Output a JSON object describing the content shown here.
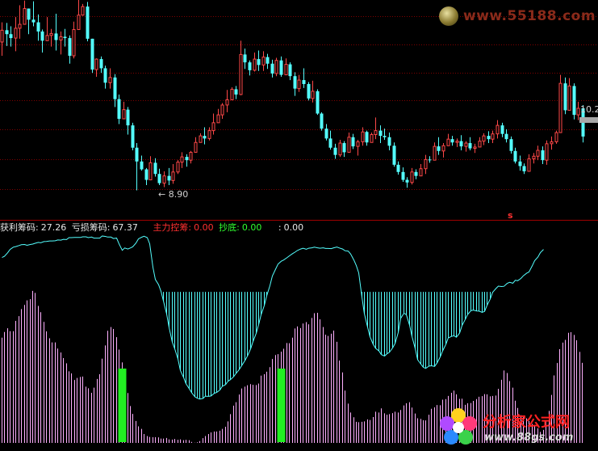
{
  "chart_data": [
    {
      "type": "candlestick",
      "title": "",
      "ylim": [
        8.5,
        11.8
      ],
      "grid": true,
      "annotations": {
        "low_label": "8.90",
        "high_label": "10.2",
        "signal_label": "s"
      },
      "colors": {
        "up": "#ff4848",
        "down": "#54ffff",
        "grid": "#800000"
      },
      "candles": [
        [
          11.16,
          11.46,
          10.95,
          11.34
        ],
        [
          11.34,
          11.45,
          11.1,
          11.28
        ],
        [
          11.28,
          11.4,
          11.09,
          11.22
        ],
        [
          11.22,
          11.54,
          11.02,
          11.37
        ],
        [
          11.37,
          11.72,
          11.21,
          11.43
        ],
        [
          11.43,
          11.79,
          11.43,
          11.67
        ],
        [
          11.67,
          11.67,
          11.28,
          11.5
        ],
        [
          11.5,
          11.78,
          11.4,
          11.46
        ],
        [
          11.46,
          11.58,
          11.18,
          11.32
        ],
        [
          11.32,
          11.35,
          11.0,
          11.18
        ],
        [
          11.18,
          11.54,
          11.18,
          11.26
        ],
        [
          11.26,
          11.36,
          11.09,
          11.29
        ],
        [
          11.29,
          11.59,
          11.03,
          11.19
        ],
        [
          11.19,
          11.32,
          10.97,
          11.24
        ],
        [
          11.24,
          11.36,
          11.09,
          11.22
        ],
        [
          11.22,
          11.26,
          10.83,
          10.95
        ],
        [
          10.95,
          11.47,
          10.91,
          11.35
        ],
        [
          11.35,
          11.87,
          11.35,
          11.57
        ],
        [
          11.57,
          11.74,
          11.56,
          11.7
        ],
        [
          11.7,
          11.77,
          11.17,
          11.21
        ],
        [
          11.21,
          11.21,
          10.69,
          10.74
        ],
        [
          10.74,
          10.91,
          10.63,
          10.9
        ],
        [
          10.9,
          10.94,
          10.69,
          10.76
        ],
        [
          10.76,
          10.8,
          10.45,
          10.54
        ],
        [
          10.54,
          10.76,
          10.45,
          10.62
        ],
        [
          10.62,
          10.67,
          10.17,
          10.29
        ],
        [
          10.29,
          10.36,
          9.91,
          9.99
        ],
        [
          9.99,
          10.25,
          9.99,
          10.13
        ],
        [
          10.13,
          10.17,
          9.75,
          9.89
        ],
        [
          9.89,
          9.93,
          9.51,
          9.55
        ],
        [
          9.55,
          9.62,
          8.9,
          9.34
        ],
        [
          9.34,
          9.43,
          9.2,
          9.22
        ],
        [
          9.22,
          9.24,
          8.98,
          9.06
        ],
        [
          9.06,
          9.42,
          9.06,
          9.32
        ],
        [
          9.32,
          9.39,
          9.11,
          9.15
        ],
        [
          9.15,
          9.23,
          8.98,
          9.01
        ],
        [
          9.01,
          9.19,
          8.95,
          9.12
        ],
        [
          9.12,
          9.24,
          8.98,
          9.05
        ],
        [
          9.05,
          9.3,
          9.0,
          9.18
        ],
        [
          9.18,
          9.36,
          9.15,
          9.33
        ],
        [
          9.33,
          9.48,
          9.24,
          9.41
        ],
        [
          9.41,
          9.45,
          9.26,
          9.36
        ],
        [
          9.36,
          9.5,
          9.31,
          9.48
        ],
        [
          9.48,
          9.71,
          9.48,
          9.63
        ],
        [
          9.63,
          9.77,
          9.63,
          9.73
        ],
        [
          9.73,
          9.86,
          9.6,
          9.69
        ],
        [
          9.69,
          9.86,
          9.66,
          9.81
        ],
        [
          9.81,
          10.07,
          9.75,
          9.93
        ],
        [
          9.93,
          10.14,
          9.93,
          10.05
        ],
        [
          10.05,
          10.23,
          9.99,
          10.2
        ],
        [
          10.2,
          10.43,
          10.09,
          10.28
        ],
        [
          10.28,
          10.47,
          10.28,
          10.44
        ],
        [
          10.44,
          10.49,
          10.29,
          10.36
        ],
        [
          10.36,
          11.18,
          10.35,
          10.97
        ],
        [
          10.97,
          11.06,
          10.75,
          10.85
        ],
        [
          10.85,
          10.88,
          10.65,
          10.73
        ],
        [
          10.73,
          11.0,
          10.71,
          10.9
        ],
        [
          10.9,
          11.03,
          10.72,
          10.81
        ],
        [
          10.81,
          11.02,
          10.72,
          10.93
        ],
        [
          10.93,
          10.98,
          10.75,
          10.83
        ],
        [
          10.83,
          10.89,
          10.62,
          10.68
        ],
        [
          10.68,
          10.92,
          10.64,
          10.88
        ],
        [
          10.88,
          10.94,
          10.63,
          10.66
        ],
        [
          10.66,
          10.91,
          10.66,
          10.82
        ],
        [
          10.82,
          10.85,
          10.58,
          10.64
        ],
        [
          10.64,
          10.7,
          10.34,
          10.45
        ],
        [
          10.45,
          10.66,
          10.4,
          10.58
        ],
        [
          10.58,
          10.76,
          10.46,
          10.52
        ],
        [
          10.52,
          10.55,
          10.27,
          10.3
        ],
        [
          10.3,
          10.57,
          10.24,
          10.41
        ],
        [
          10.41,
          10.44,
          10.05,
          10.07
        ],
        [
          10.07,
          10.09,
          9.81,
          9.84
        ],
        [
          9.84,
          9.91,
          9.66,
          9.69
        ],
        [
          9.69,
          9.81,
          9.52,
          9.55
        ],
        [
          9.55,
          9.61,
          9.38,
          9.44
        ],
        [
          9.44,
          9.67,
          9.41,
          9.62
        ],
        [
          9.62,
          9.65,
          9.41,
          9.48
        ],
        [
          9.48,
          9.78,
          9.48,
          9.71
        ],
        [
          9.71,
          9.76,
          9.53,
          9.57
        ],
        [
          9.57,
          9.67,
          9.43,
          9.64
        ],
        [
          9.64,
          9.86,
          9.58,
          9.79
        ],
        [
          9.79,
          9.81,
          9.58,
          9.63
        ],
        [
          9.63,
          9.78,
          9.63,
          9.75
        ],
        [
          9.75,
          10.01,
          9.68,
          9.81
        ],
        [
          9.81,
          9.89,
          9.62,
          9.73
        ],
        [
          9.73,
          9.84,
          9.67,
          9.71
        ],
        [
          9.71,
          9.78,
          9.51,
          9.58
        ],
        [
          9.58,
          9.63,
          9.26,
          9.29
        ],
        [
          9.29,
          9.34,
          9.14,
          9.18
        ],
        [
          9.18,
          9.25,
          9.03,
          9.06
        ],
        [
          9.06,
          9.1,
          8.94,
          9.02
        ],
        [
          9.02,
          9.24,
          8.99,
          9.18
        ],
        [
          9.18,
          9.22,
          9.07,
          9.12
        ],
        [
          9.12,
          9.3,
          9.12,
          9.23
        ],
        [
          9.23,
          9.44,
          9.15,
          9.37
        ],
        [
          9.37,
          9.42,
          9.32,
          9.36
        ],
        [
          9.36,
          9.63,
          9.36,
          9.57
        ],
        [
          9.57,
          9.71,
          9.44,
          9.5
        ],
        [
          9.5,
          9.62,
          9.4,
          9.58
        ],
        [
          9.58,
          9.76,
          9.58,
          9.68
        ],
        [
          9.68,
          9.73,
          9.58,
          9.63
        ],
        [
          9.63,
          9.69,
          9.56,
          9.65
        ],
        [
          9.65,
          9.74,
          9.51,
          9.57
        ],
        [
          9.57,
          9.65,
          9.49,
          9.62
        ],
        [
          9.62,
          9.71,
          9.51,
          9.54
        ],
        [
          9.54,
          9.61,
          9.47,
          9.56
        ],
        [
          9.56,
          9.71,
          9.56,
          9.65
        ],
        [
          9.65,
          9.77,
          9.59,
          9.73
        ],
        [
          9.73,
          9.8,
          9.62,
          9.68
        ],
        [
          9.68,
          9.81,
          9.62,
          9.76
        ],
        [
          9.76,
          9.97,
          9.69,
          9.89
        ],
        [
          9.89,
          9.93,
          9.71,
          9.76
        ],
        [
          9.76,
          9.83,
          9.63,
          9.68
        ],
        [
          9.68,
          9.72,
          9.46,
          9.5
        ],
        [
          9.5,
          9.55,
          9.31,
          9.34
        ],
        [
          9.34,
          9.43,
          9.2,
          9.27
        ],
        [
          9.27,
          9.31,
          9.15,
          9.19
        ],
        [
          9.19,
          9.45,
          9.19,
          9.38
        ],
        [
          9.38,
          9.47,
          9.31,
          9.42
        ],
        [
          9.42,
          9.58,
          9.36,
          9.51
        ],
        [
          9.51,
          9.57,
          9.3,
          9.36
        ],
        [
          9.36,
          9.66,
          9.29,
          9.61
        ],
        [
          9.61,
          9.72,
          9.52,
          9.64
        ],
        [
          9.64,
          9.81,
          9.61,
          9.78
        ],
        [
          9.78,
          10.66,
          9.78,
          10.53
        ],
        [
          10.53,
          10.62,
          10.06,
          10.12
        ],
        [
          10.12,
          10.61,
          10.12,
          10.49
        ],
        [
          10.49,
          10.53,
          9.98,
          10.05
        ],
        [
          10.05,
          10.25,
          9.97,
          10.15
        ],
        [
          10.15,
          10.2,
          9.63,
          9.72
        ]
      ]
    },
    {
      "type": "indicator",
      "title": "",
      "legend": [
        {
          "label": "获利筹码:",
          "value": "27.26",
          "color": "#e8e8e8"
        },
        {
          "label": "亏损筹码:",
          "value": "67.37",
          "color": "#e8e8e8"
        },
        {
          "label": "主力控筹:",
          "value": "0.00",
          "color": "#ff3030"
        },
        {
          "label": "抄底:",
          "value": "0.00",
          "color": "#30ff30"
        },
        {
          "label": ":",
          "value": "0.00",
          "color": "#e8e8e8"
        }
      ],
      "ylim": [
        0,
        100
      ],
      "colors": {
        "line": "#54ffff",
        "fill": "#54ffff",
        "bars": "#ffb0ff",
        "signal": "#22ee22"
      },
      "line_values": [
        89.6,
        90.2,
        91.9,
        93.5,
        94.6,
        94.9,
        95.4,
        95.8,
        95.9,
        95.5,
        95.9,
        96.1,
        96.5,
        96.9,
        96.7,
        97.3,
        97.4,
        97.6,
        97.6,
        97.7,
        98.1,
        98.0,
        98.4,
        98.3,
        99.2,
        99.2,
        99.3,
        99.3,
        99.3,
        99.6,
        99.6,
        99.2,
        99.5,
        99.0,
        99.0,
        99.0,
        100.0,
        99.8,
        99.5,
        99.5,
        98.8,
        99.0,
        96.2,
        93.1,
        94.2,
        93.7,
        94.2,
        94.8,
        96.6,
        98.6,
        99.4,
        99.9,
        99.2,
        96.2,
        84.9,
        79.0,
        76.5,
        73.3,
        68.6,
        62.3,
        55.8,
        48.7,
        45.5,
        40.6,
        35.0,
        31.6,
        28.6,
        26.2,
        24.3,
        22.3,
        21.6,
        21.2,
        21.5,
        22.6,
        22.5,
        22.7,
        24.0,
        24.4,
        25.6,
        27.4,
        28.2,
        29.8,
        30.6,
        32.0,
        33.6,
        35.5,
        37.4,
        39.8,
        41.9,
        45.4,
        49.0,
        53.0,
        57.2,
        61.9,
        66.4,
        71.1,
        76.0,
        80.7,
        84.0,
        86.4,
        87.8,
        88.4,
        89.5,
        90.4,
        91.5,
        92.2,
        93.0,
        93.7,
        94.1,
        93.6,
        94.1,
        94.3,
        94.6,
        94.3,
        94.1,
        94.3,
        94.0,
        94.0,
        93.9,
        94.3,
        94.7,
        94.2,
        93.7,
        92.9,
        92.7,
        91.3,
        88.4,
        85.7,
        82.2,
        70.4,
        62.4,
        55.9,
        51.3,
        47.6,
        45.7,
        44.5,
        42.7,
        42.0,
        43.1,
        43.8,
        45.9,
        48.0,
        53.4,
        60.2,
        62.7,
        62.0,
        56.9,
        51.5,
        45.6,
        40.2,
        38.1,
        36.6,
        36.0,
        37.1,
        37.3,
        37.0,
        38.6,
        41.6,
        44.5,
        47.6,
        50.8,
        51.5,
        51.8,
        51.1,
        53.1,
        56.7,
        59.7,
        62.1,
        63.9,
        64.2,
        63.8,
        63.7,
        63.1,
        63.6,
        66.5,
        69.6,
        72.8,
        74.6,
        75.8,
        75.6,
        75.7,
        77.1,
        77.6,
        77.2,
        78.6,
        78.4,
        79.5,
        80.8,
        82.0,
        82.6,
        85.6,
        88.1,
        89.8,
        91.9,
        93.5
      ],
      "bar_values": [
        50.9,
        53.6,
        55.4,
        54.0,
        54.0,
        59.0,
        61.3,
        64.7,
        66.7,
        68.9,
        69.5,
        73.5,
        72.5,
        66.2,
        63.2,
        58.5,
        53.9,
        50.6,
        48.6,
        48.6,
        45.6,
        43.7,
        41.0,
        38.5,
        34.6,
        33.6,
        30.4,
        31.4,
        31.9,
        32.1,
        27.2,
        26.4,
        24.2,
        26.7,
        30.9,
        33.2,
        40.7,
        47.1,
        54.2,
        56.0,
        55.1,
        51.1,
        45.1,
        38.9,
        31.5,
        24.1,
        17.8,
        14.0,
        10.6,
        8.0,
        6.8,
        4.3,
        3.3,
        2.9,
        2.8,
        2.8,
        2.7,
        2.1,
        2.1,
        2.4,
        1.7,
        1.6,
        1.9,
        1.5,
        1.7,
        1.3,
        1.5,
        1.3,
        0.5,
        0.1,
        0.3,
        0.9,
        2.3,
        3.3,
        4.3,
        5.1,
        5.5,
        5.5,
        5.9,
        6.8,
        7.8,
        10.4,
        13.9,
        18.0,
        19.7,
        23.4,
        26.3,
        27.2,
        27.9,
        28.4,
        28.1,
        28.0,
        28.7,
        32.5,
        33.2,
        34.4,
        36.6,
        40.6,
        42.5,
        42.9,
        44.1,
        45.5,
        48.3,
        48.2,
        50.9,
        55.3,
        56.3,
        55.5,
        57.7,
        58.4,
        57.3,
        60.4,
        62.7,
        62.9,
        59.7,
        56.0,
        52.3,
        51.7,
        52.8,
        54.3,
        48.9,
        39.8,
        34.1,
        25.3,
        19.0,
        14.7,
        12.4,
        10.2,
        10.0,
        10.2,
        10.4,
        11.4,
        11.1,
        12.5,
        15.1,
        14.7,
        16.7,
        14.3,
        13.6,
        13.9,
        14.4,
        15.1,
        14.7,
        15.9,
        18.1,
        19.2,
        19.7,
        17.1,
        14.2,
        11.9,
        11.6,
        11.0,
        10.9,
        13.6,
        16.5,
        17.2,
        18.3,
        18.2,
        20.9,
        21.2,
        22.7,
        24.2,
        25.3,
        23.5,
        21.3,
        21.4,
        18.4,
        19.2,
        19.3,
        20.3,
        21.2,
        22.3,
        22.6,
        23.6,
        23.5,
        22.5,
        22.7,
        22.9,
        26.1,
        30.5,
        35.0,
        33.8,
        29.9,
        26.7,
        20.4,
        16.9,
        13.4,
        12.4,
        11.9,
        10.6,
        9.2,
        8.0,
        7.1,
        5.3,
        6.3,
        10.3,
        15.5,
        23.2,
        32.6,
        38.6,
        45.3,
        48.5,
        49.8,
        53.2,
        53.5,
        52.2,
        49.6,
        44.0,
        38.7
      ],
      "fill_region": {
        "start_index": 41,
        "end_index": 182,
        "baseline_value": 73.0
      },
      "signal_indices": [
        43,
        100
      ]
    }
  ],
  "watermarks": {
    "top": "www.55188.com",
    "bottom_cn": "分析家公式网",
    "bottom_url": "www.88gs.com"
  }
}
